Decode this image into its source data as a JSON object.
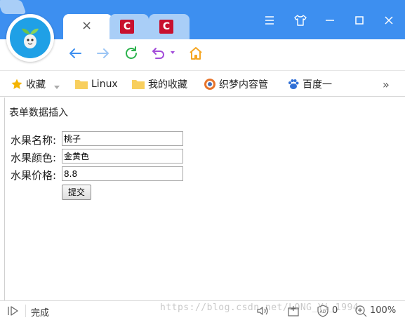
{
  "browser": {
    "tabs": [
      {
        "close_symbol": "×",
        "active": true
      },
      {
        "icon": "c-site-icon"
      },
      {
        "icon": "c-site-icon"
      }
    ],
    "tab_icon_letter": "C",
    "window_buttons": [
      "menu-icon",
      "skin-icon",
      "minimize-icon",
      "maximize-icon",
      "close-icon"
    ],
    "nav_buttons": [
      "back-icon",
      "forward-icon",
      "refresh-icon",
      "undo-icon",
      "home-icon"
    ],
    "accent": "#3d8ff0",
    "tab_inactive_color": "#a9cef7"
  },
  "bookmarks": {
    "items": [
      {
        "label": "收藏",
        "icon": "star-icon"
      },
      {
        "label": "Linux",
        "icon": "folder-icon"
      },
      {
        "label": "我的收藏",
        "icon": "folder-icon"
      },
      {
        "label": "织梦内容管",
        "icon": "dedecms-icon"
      },
      {
        "label": "百度一",
        "icon": "baidu-paw-icon"
      }
    ],
    "more_symbol": "»"
  },
  "page": {
    "heading": "表单数据插入",
    "fields": [
      {
        "label": "水果名称:",
        "value": "桃子"
      },
      {
        "label": "水果颜色:",
        "value": "金黄色"
      },
      {
        "label": "水果价格:",
        "value": "8.8"
      }
    ],
    "submit_label": "提交"
  },
  "statusbar": {
    "status_text": "完成",
    "watermark": "https://blog.csdn.net/LONG_Yi_1994",
    "ad_count": "0",
    "zoom": "100%"
  }
}
